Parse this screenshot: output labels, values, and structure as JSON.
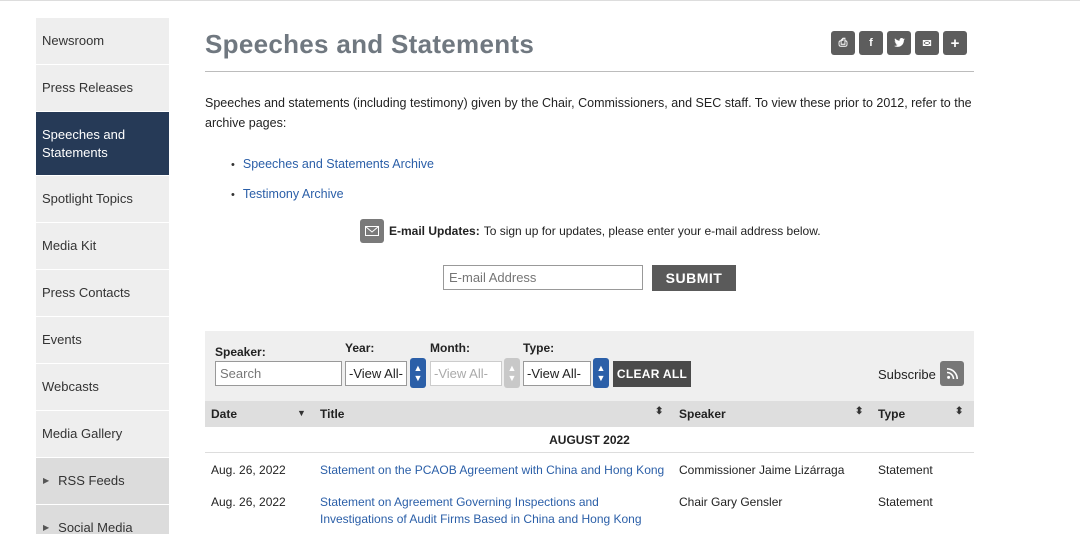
{
  "sidebar": {
    "items": [
      {
        "label": "Newsroom"
      },
      {
        "label": "Press Releases"
      },
      {
        "label": "Speeches and Statements"
      },
      {
        "label": "Spotlight Topics"
      },
      {
        "label": "Media Kit"
      },
      {
        "label": "Press Contacts"
      },
      {
        "label": "Events"
      },
      {
        "label": "Webcasts"
      },
      {
        "label": "Media Gallery"
      },
      {
        "label": "RSS Feeds"
      },
      {
        "label": "Social Media"
      }
    ]
  },
  "page": {
    "title": "Speeches and Statements",
    "intro": "Speeches and statements (including testimony) given by the Chair, Commissioners, and SEC staff.  To view these prior to 2012, refer to the archive pages:",
    "links": [
      "Speeches and Statements Archive",
      "Testimony Archive"
    ]
  },
  "share": {
    "icons": [
      "print-icon",
      "facebook-icon",
      "twitter-icon",
      "email-icon",
      "plus-icon"
    ],
    "glyphs": [
      "⎙",
      "f",
      "y",
      "✉",
      "+"
    ]
  },
  "email_updates": {
    "label": "E-mail Updates:",
    "text": "To sign up for updates, please enter your e-mail address below.",
    "placeholder": "E-mail Address",
    "submit": "SUBMIT"
  },
  "filters": {
    "speaker_label": "Speaker:",
    "year_label": "Year:",
    "month_label": "Month:",
    "type_label": "Type:",
    "search_placeholder": "Search",
    "year_value": "-View All-",
    "month_value": "-View All-",
    "type_value": "-View All-",
    "clear_all": "CLEAR ALL",
    "subscribe": "Subscribe"
  },
  "table": {
    "headers": {
      "date": "Date",
      "title": "Title",
      "speaker": "Speaker",
      "type": "Type"
    },
    "month_group": "AUGUST 2022",
    "rows": [
      {
        "date": "Aug. 26, 2022",
        "title": "Statement on the PCAOB Agreement with China and Hong Kong",
        "speaker": "Commissioner Jaime Lizárraga",
        "type": "Statement"
      },
      {
        "date": "Aug. 26, 2022",
        "title": "Statement on Agreement Governing Inspections and Investigations of Audit Firms Based in China and Hong Kong",
        "speaker": "Chair Gary Gensler",
        "type": "Statement"
      }
    ]
  },
  "colors": {
    "accent": "#263a57",
    "link": "#2b5fa8"
  }
}
